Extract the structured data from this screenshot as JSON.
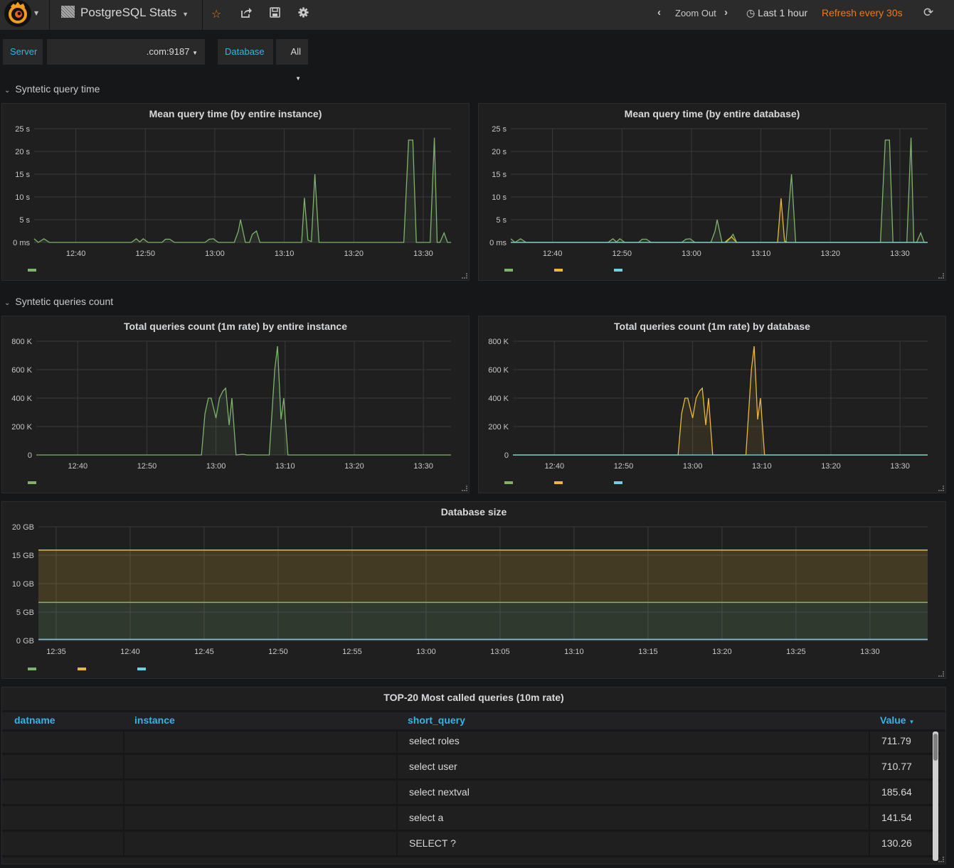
{
  "navbar": {
    "dashboard_title": "PostgreSQL Stats",
    "icons": [
      "grafana-logo-icon",
      "star-icon",
      "share-icon",
      "save-icon",
      "gear-icon"
    ],
    "zoom_out_label": "Zoom Out",
    "time_range": "Last 1 hour",
    "refresh_label": "Refresh every 30s"
  },
  "variables": {
    "server_label": "Server",
    "server_value": ".com:9187",
    "database_label": "Database",
    "database_value": "All"
  },
  "rows": [
    {
      "title": "Syntetic query time"
    },
    {
      "title": "Syntetic queries count"
    }
  ],
  "colors": {
    "green": "#7eb26d",
    "yellow": "#eab839",
    "cyan": "#6ed0e0",
    "accent_blue": "#33b5e5",
    "orange": "#eb7b18"
  },
  "chart_data": [
    {
      "id": "mean-query-instance",
      "type": "area",
      "title": "Mean query time (by entire instance)",
      "x_unit": "minutes since 12:34",
      "xlim": [
        0,
        60
      ],
      "x_ticks": [
        {
          "t": 6,
          "label": "12:40"
        },
        {
          "t": 16,
          "label": "12:50"
        },
        {
          "t": 26,
          "label": "13:00"
        },
        {
          "t": 36,
          "label": "13:10"
        },
        {
          "t": 46,
          "label": "13:20"
        },
        {
          "t": 56,
          "label": "13:30"
        }
      ],
      "ylim": [
        0,
        25
      ],
      "y_ticks": [
        {
          "v": 0,
          "label": "0 ms"
        },
        {
          "v": 5,
          "label": "5 s"
        },
        {
          "v": 10,
          "label": "10 s"
        },
        {
          "v": 15,
          "label": "15 s"
        },
        {
          "v": 20,
          "label": "20 s"
        },
        {
          "v": 25,
          "label": "25 s"
        }
      ],
      "series": [
        {
          "name": "",
          "color": "#7eb26d",
          "points": [
            [
              0,
              0.8
            ],
            [
              0.6,
              0
            ],
            [
              1.4,
              0.8
            ],
            [
              2.2,
              0
            ],
            [
              14.0,
              0
            ],
            [
              14.7,
              0.8
            ],
            [
              15.2,
              0.1
            ],
            [
              15.7,
              0.8
            ],
            [
              16.4,
              0
            ],
            [
              18.4,
              0
            ],
            [
              18.9,
              0.7
            ],
            [
              19.5,
              0.7
            ],
            [
              20.2,
              0
            ],
            [
              24.6,
              0
            ],
            [
              25.2,
              0.7
            ],
            [
              25.8,
              0.8
            ],
            [
              26.5,
              0
            ],
            [
              28.8,
              0
            ],
            [
              29.4,
              2.5
            ],
            [
              29.7,
              5.0
            ],
            [
              30.4,
              0
            ],
            [
              31.0,
              0
            ],
            [
              31.4,
              1.8
            ],
            [
              32.0,
              2.5
            ],
            [
              32.5,
              0
            ],
            [
              38.5,
              0
            ],
            [
              38.9,
              9.8
            ],
            [
              39.4,
              0.5
            ],
            [
              39.9,
              0.2
            ],
            [
              40.4,
              15.0
            ],
            [
              41.0,
              0
            ],
            [
              53.2,
              0
            ],
            [
              53.9,
              22.5
            ],
            [
              54.5,
              22.5
            ],
            [
              55.0,
              0
            ],
            [
              57.0,
              0
            ],
            [
              57.6,
              23.0
            ],
            [
              58.0,
              0
            ],
            [
              58.4,
              0
            ],
            [
              59.0,
              2.1
            ],
            [
              59.5,
              0
            ],
            [
              60,
              0
            ]
          ]
        }
      ],
      "legend": [
        {
          "name": "",
          "color": "#7eb26d"
        }
      ]
    },
    {
      "id": "mean-query-database",
      "type": "area",
      "title": "Mean query time (by entire database)",
      "x_unit": "minutes since 12:34",
      "xlim": [
        0,
        60
      ],
      "x_ticks": [
        {
          "t": 6,
          "label": "12:40"
        },
        {
          "t": 16,
          "label": "12:50"
        },
        {
          "t": 26,
          "label": "13:00"
        },
        {
          "t": 36,
          "label": "13:10"
        },
        {
          "t": 46,
          "label": "13:20"
        },
        {
          "t": 56,
          "label": "13:30"
        }
      ],
      "ylim": [
        0,
        25
      ],
      "y_ticks": [
        {
          "v": 0,
          "label": "0 ms"
        },
        {
          "v": 5,
          "label": "5 s"
        },
        {
          "v": 10,
          "label": "10 s"
        },
        {
          "v": 15,
          "label": "15 s"
        },
        {
          "v": 20,
          "label": "20 s"
        },
        {
          "v": 25,
          "label": "25 s"
        }
      ],
      "series": [
        {
          "name": "",
          "color": "#7eb26d",
          "points": [
            [
              0,
              0.8
            ],
            [
              0.6,
              0
            ],
            [
              1.4,
              0.8
            ],
            [
              2.2,
              0
            ],
            [
              14.0,
              0
            ],
            [
              14.7,
              0.8
            ],
            [
              15.2,
              0.1
            ],
            [
              15.7,
              0.8
            ],
            [
              16.4,
              0
            ],
            [
              18.4,
              0
            ],
            [
              18.9,
              0.7
            ],
            [
              19.5,
              0.7
            ],
            [
              20.2,
              0
            ],
            [
              24.6,
              0
            ],
            [
              25.2,
              0.7
            ],
            [
              25.8,
              0.8
            ],
            [
              26.5,
              0
            ],
            [
              28.8,
              0
            ],
            [
              29.4,
              2.5
            ],
            [
              29.7,
              5.0
            ],
            [
              30.4,
              0
            ],
            [
              31.0,
              0
            ],
            [
              31.6,
              1.0
            ],
            [
              32.0,
              1.8
            ],
            [
              32.5,
              0
            ],
            [
              39.6,
              0
            ],
            [
              40.4,
              15.0
            ],
            [
              41.0,
              0
            ],
            [
              53.2,
              0
            ],
            [
              53.9,
              22.5
            ],
            [
              54.5,
              22.5
            ],
            [
              55.0,
              0
            ],
            [
              57.0,
              0
            ],
            [
              57.6,
              23.0
            ],
            [
              58.0,
              0
            ],
            [
              58.4,
              0
            ],
            [
              59.0,
              2.1
            ],
            [
              59.5,
              0
            ],
            [
              60,
              0
            ]
          ]
        },
        {
          "name": "",
          "color": "#eab839",
          "points": [
            [
              0,
              0
            ],
            [
              30.8,
              0
            ],
            [
              31.4,
              0.8
            ],
            [
              31.8,
              1.2
            ],
            [
              32.5,
              0
            ],
            [
              38.4,
              0
            ],
            [
              38.9,
              9.7
            ],
            [
              39.4,
              0.3
            ],
            [
              39.8,
              0
            ],
            [
              60,
              0
            ]
          ]
        },
        {
          "name": "",
          "color": "#6ed0e0",
          "points": [
            [
              0,
              0
            ],
            [
              60,
              0
            ]
          ]
        }
      ],
      "legend": [
        {
          "name": "",
          "color": "#7eb26d"
        },
        {
          "name": "",
          "color": "#eab839"
        },
        {
          "name": "",
          "color": "#6ed0e0"
        }
      ]
    },
    {
      "id": "queries-count-instance",
      "type": "area",
      "title": "Total queries count (1m rate) by entire instance",
      "x_unit": "minutes since 12:34",
      "xlim": [
        0,
        60
      ],
      "x_ticks": [
        {
          "t": 6,
          "label": "12:40"
        },
        {
          "t": 16,
          "label": "12:50"
        },
        {
          "t": 26,
          "label": "13:00"
        },
        {
          "t": 36,
          "label": "13:10"
        },
        {
          "t": 46,
          "label": "13:20"
        },
        {
          "t": 56,
          "label": "13:30"
        }
      ],
      "ylim": [
        0,
        800000
      ],
      "y_ticks": [
        {
          "v": 0,
          "label": "0"
        },
        {
          "v": 200000,
          "label": "200 K"
        },
        {
          "v": 400000,
          "label": "400 K"
        },
        {
          "v": 600000,
          "label": "600 K"
        },
        {
          "v": 800000,
          "label": "800 K"
        }
      ],
      "series": [
        {
          "name": "",
          "color": "#7eb26d",
          "points": [
            [
              0,
              0
            ],
            [
              23.9,
              0
            ],
            [
              24.4,
              290000
            ],
            [
              24.9,
              400000
            ],
            [
              25.3,
              400000
            ],
            [
              26.0,
              260000
            ],
            [
              26.5,
              400000
            ],
            [
              27.0,
              450000
            ],
            [
              27.4,
              470000
            ],
            [
              27.9,
              210000
            ],
            [
              28.3,
              400000
            ],
            [
              28.9,
              0
            ],
            [
              29.9,
              5000
            ],
            [
              30.5,
              0
            ],
            [
              33.7,
              0
            ],
            [
              34.5,
              600000
            ],
            [
              34.9,
              765000
            ],
            [
              35.4,
              250000
            ],
            [
              35.8,
              400000
            ],
            [
              36.4,
              0
            ],
            [
              60,
              0
            ]
          ]
        }
      ],
      "legend": [
        {
          "name": "",
          "color": "#7eb26d"
        }
      ]
    },
    {
      "id": "queries-count-database",
      "type": "area",
      "title": "Total queries count (1m rate) by database",
      "x_unit": "minutes since 12:34",
      "xlim": [
        0,
        60
      ],
      "x_ticks": [
        {
          "t": 6,
          "label": "12:40"
        },
        {
          "t": 16,
          "label": "12:50"
        },
        {
          "t": 26,
          "label": "13:00"
        },
        {
          "t": 36,
          "label": "13:10"
        },
        {
          "t": 46,
          "label": "13:20"
        },
        {
          "t": 56,
          "label": "13:30"
        }
      ],
      "ylim": [
        0,
        800000
      ],
      "y_ticks": [
        {
          "v": 0,
          "label": "0"
        },
        {
          "v": 200000,
          "label": "200 K"
        },
        {
          "v": 400000,
          "label": "400 K"
        },
        {
          "v": 600000,
          "label": "600 K"
        },
        {
          "v": 800000,
          "label": "800 K"
        }
      ],
      "series": [
        {
          "name": "",
          "color": "#eab839",
          "points": [
            [
              0,
              0
            ],
            [
              23.9,
              0
            ],
            [
              24.4,
              290000
            ],
            [
              24.9,
              400000
            ],
            [
              25.3,
              400000
            ],
            [
              26.0,
              260000
            ],
            [
              26.5,
              400000
            ],
            [
              27.0,
              450000
            ],
            [
              27.4,
              470000
            ],
            [
              27.9,
              210000
            ],
            [
              28.3,
              400000
            ],
            [
              28.9,
              0
            ],
            [
              33.7,
              0
            ],
            [
              34.5,
              600000
            ],
            [
              34.9,
              765000
            ],
            [
              35.4,
              250000
            ],
            [
              35.8,
              400000
            ],
            [
              36.4,
              0
            ],
            [
              60,
              0
            ]
          ]
        },
        {
          "name": "",
          "color": "#7eb26d",
          "points": [
            [
              0,
              0
            ],
            [
              60,
              0
            ]
          ]
        },
        {
          "name": "",
          "color": "#6ed0e0",
          "points": [
            [
              0,
              0
            ],
            [
              60,
              0
            ]
          ]
        }
      ],
      "legend": [
        {
          "name": "",
          "color": "#7eb26d"
        },
        {
          "name": "",
          "color": "#eab839"
        },
        {
          "name": "",
          "color": "#6ed0e0"
        }
      ]
    },
    {
      "id": "database-size",
      "type": "area",
      "title": "Database size",
      "x_unit": "minutes since 12:35",
      "xlim": [
        -1.2,
        58.9
      ],
      "x_ticks": [
        {
          "t": 0,
          "label": "12:35"
        },
        {
          "t": 5,
          "label": "12:40"
        },
        {
          "t": 10,
          "label": "12:45"
        },
        {
          "t": 15,
          "label": "12:50"
        },
        {
          "t": 20,
          "label": "12:55"
        },
        {
          "t": 25,
          "label": "13:00"
        },
        {
          "t": 30,
          "label": "13:05"
        },
        {
          "t": 35,
          "label": "13:10"
        },
        {
          "t": 40,
          "label": "13:15"
        },
        {
          "t": 45,
          "label": "13:20"
        },
        {
          "t": 50,
          "label": "13:25"
        },
        {
          "t": 55,
          "label": "13:30"
        }
      ],
      "ylim": [
        0,
        20
      ],
      "y_ticks": [
        {
          "v": 0,
          "label": "0 GB"
        },
        {
          "v": 5,
          "label": "5 GB"
        },
        {
          "v": 10,
          "label": "10 GB"
        },
        {
          "v": 15,
          "label": "15 GB"
        },
        {
          "v": 20,
          "label": "20 GB"
        }
      ],
      "stacked": true,
      "series": [
        {
          "name": "",
          "color": "#6ed0e0",
          "values_gb": 0.2
        },
        {
          "name": "",
          "color": "#7eb26d",
          "values_gb": 6.5
        },
        {
          "name": "",
          "color": "#eab839",
          "values_gb": 9.2
        }
      ],
      "series_totals_gb": {
        "cyan": 0.2,
        "green": 6.7,
        "yellow": 15.7
      },
      "legend": [
        {
          "name": "",
          "color": "#7eb26d"
        },
        {
          "name": "",
          "color": "#eab839"
        },
        {
          "name": "",
          "color": "#6ed0e0"
        }
      ]
    }
  ],
  "table": {
    "title": "TOP-20 Most called queries (10m rate)",
    "columns": [
      "datname",
      "instance",
      "short_query",
      "Value"
    ],
    "sort_column": "Value",
    "rows": [
      {
        "datname": "",
        "instance": "",
        "short_query": "select roles",
        "value": "711.79"
      },
      {
        "datname": "",
        "instance": "",
        "short_query": "select user",
        "value": "710.77"
      },
      {
        "datname": "",
        "instance": "",
        "short_query": "select nextval",
        "value": "185.64"
      },
      {
        "datname": "",
        "instance": "",
        "short_query": "select a",
        "value": "141.54"
      },
      {
        "datname": "",
        "instance": "",
        "short_query": "SELECT ?",
        "value": "130.26"
      }
    ]
  }
}
